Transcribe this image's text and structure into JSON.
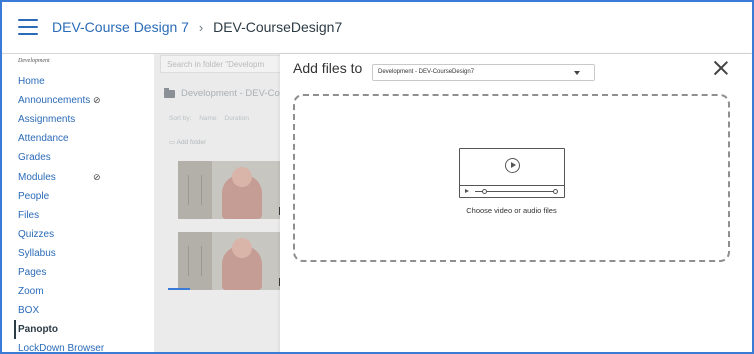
{
  "header": {
    "breadcrumb_course": "DEV-Course Design 7",
    "breadcrumb_separator": "›",
    "breadcrumb_current": "DEV-CourseDesign7"
  },
  "sidebar": {
    "heading": "Development",
    "items": [
      {
        "label": "Home"
      },
      {
        "label": "Announcements",
        "hidden_icon": "eye-slash-icon"
      },
      {
        "label": "Assignments"
      },
      {
        "label": "Attendance"
      },
      {
        "label": "Grades"
      },
      {
        "label": "Modules",
        "hidden_icon": "eye-slash-icon"
      },
      {
        "label": "People"
      },
      {
        "label": "Files"
      },
      {
        "label": "Quizzes"
      },
      {
        "label": "Syllabus"
      },
      {
        "label": "Pages"
      },
      {
        "label": "Zoom"
      },
      {
        "label": "BOX"
      },
      {
        "label": "Panopto",
        "active": true
      },
      {
        "label": "LockDown Browser"
      }
    ]
  },
  "panopto": {
    "search_placeholder": "Search in folder \"Developm",
    "folder_name": "Development - DEV-Co",
    "sort_label": "Sort by:",
    "sort_options": [
      "Name",
      "Duration"
    ],
    "add_folder": "Add folder",
    "thumb_durations": [
      "0:",
      "0:"
    ]
  },
  "modal": {
    "title": "Add files to",
    "folder_select_value": "Development - DEV-CourseDesign7",
    "dropzone_text": "Choose video or audio files"
  },
  "colors": {
    "link": "#2b6bb8",
    "frame_border": "#3a7bd5",
    "dim_background": "#ebebeb"
  },
  "icons": {
    "menu": "hamburger-menu-icon",
    "close": "close-icon",
    "video": "video-file-icon",
    "folder": "folder-icon",
    "hidden": "eye-slash-icon",
    "dropdown": "caret-down-icon"
  }
}
